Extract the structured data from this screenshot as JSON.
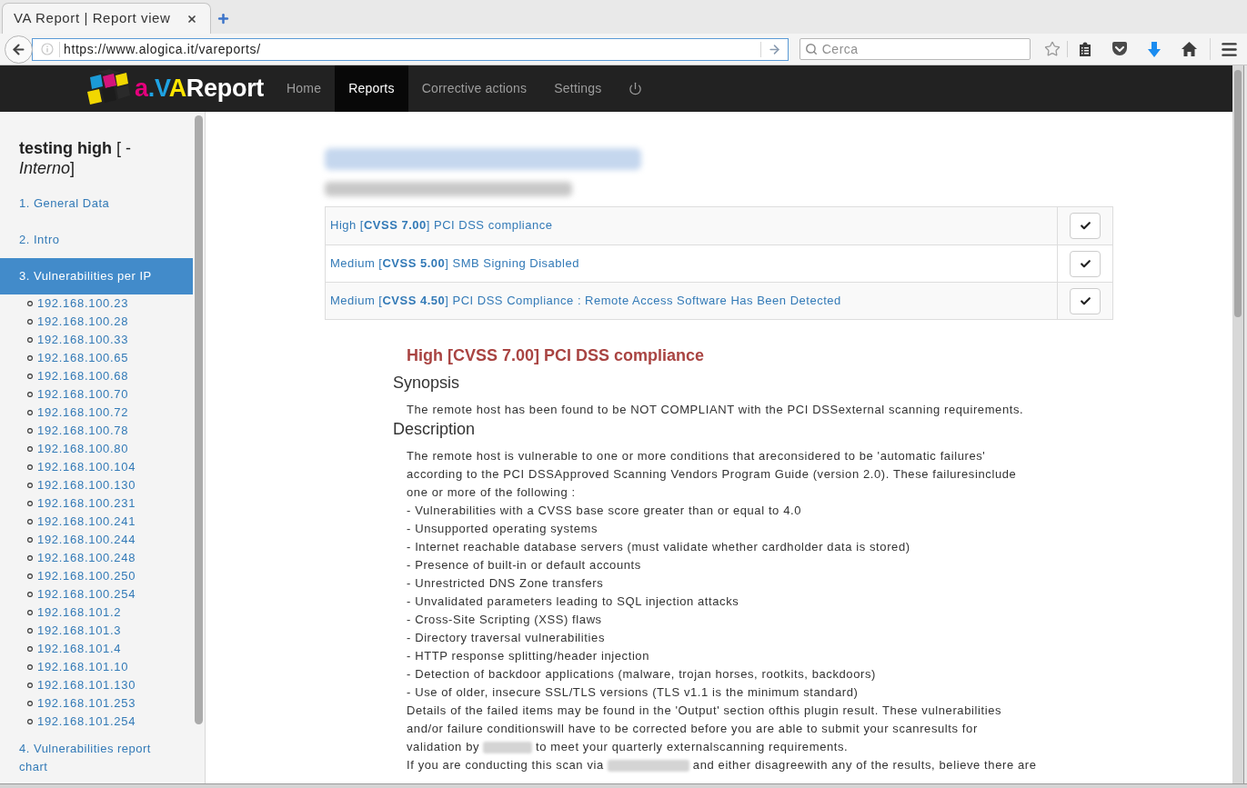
{
  "browser": {
    "tab": {
      "title": "VA Report | Report view"
    },
    "address": {
      "url": "https://www.alogica.it/vareports/"
    },
    "search": {
      "placeholder": "Cerca"
    }
  },
  "navbar": {
    "logo": [
      {
        "text": "a",
        "color": "#e5007d"
      },
      {
        "text": ".V",
        "color": "#1fa3e3"
      },
      {
        "text": "A",
        "color": "#ffe500"
      },
      {
        "text": "Report",
        "color": "#ffffff"
      }
    ],
    "items": [
      {
        "label": "Home",
        "selected": false
      },
      {
        "label": "Reports",
        "selected": true
      },
      {
        "label": "Corrective actions",
        "selected": false
      },
      {
        "label": "Settings",
        "selected": false
      }
    ]
  },
  "sidebar": {
    "title": "**testing high** [ - *Interno*]",
    "items": [
      {
        "label": "1. General Data",
        "selected": false
      },
      {
        "label": "2. Intro",
        "selected": false
      },
      {
        "label": "3. Vulnerabilities per IP",
        "selected": true,
        "children": [
          {
            "label": "192.168.100.23"
          },
          {
            "label": "192.168.100.28"
          },
          {
            "label": "192.168.100.33"
          },
          {
            "label": "192.168.100.65"
          },
          {
            "label": "192.168.100.68"
          },
          {
            "label": "192.168.100.70"
          },
          {
            "label": "192.168.100.72"
          },
          {
            "label": "192.168.100.78"
          },
          {
            "label": "192.168.100.80"
          },
          {
            "label": "192.168.100.104"
          },
          {
            "label": "192.168.100.130"
          },
          {
            "label": "192.168.100.231"
          },
          {
            "label": "192.168.100.241"
          },
          {
            "label": "192.168.100.244"
          },
          {
            "label": "192.168.100.248"
          },
          {
            "label": "192.168.100.250"
          },
          {
            "label": "192.168.100.254"
          },
          {
            "label": "192.168.101.2"
          },
          {
            "label": "192.168.101.3"
          },
          {
            "label": "192.168.101.4"
          },
          {
            "label": "192.168.101.10"
          },
          {
            "label": "192.168.101.130"
          },
          {
            "label": "192.168.101.253"
          },
          {
            "label": "192.168.101.254"
          }
        ]
      },
      {
        "label": "4. Vulnerabilities report chart",
        "selected": false
      }
    ]
  },
  "findings": {
    "rows": [
      {
        "title": "High [**CVSS 7.00**] PCI DSS compliance"
      },
      {
        "title": "Medium [**CVSS 5.00**] SMB Signing Disabled"
      },
      {
        "title": "Medium [**CVSS 4.50**] PCI DSS Compliance : Remote Access Software Has Been Detected"
      }
    ]
  },
  "detail": {
    "title": "High [CVSS 7.00] PCI DSS compliance",
    "sections": [
      {
        "heading": "Synopsis",
        "paragraphs": [
          [
            {
              "kind": "text",
              "text": "The remote host has been found to be NOT COMPLIANT with the PCI DSSexternal scanning requirements."
            }
          ]
        ]
      },
      {
        "heading": "Description",
        "paragraphs": [
          [
            {
              "kind": "text",
              "text": "The remote host is vulnerable to one or more conditions that areconsidered to be 'automatic failures' according to the PCI DSSApproved Scanning Vendors Program Guide (version 2.0). These failuresinclude one or more of the following :"
            }
          ],
          [
            {
              "kind": "text",
              "text": "- Vulnerabilities with a CVSS base score greater than or equal to 4.0"
            }
          ],
          [
            {
              "kind": "text",
              "text": "- Unsupported operating systems"
            }
          ],
          [
            {
              "kind": "text",
              "text": "- Internet reachable database servers (must validate whether cardholder data is stored)"
            }
          ],
          [
            {
              "kind": "text",
              "text": "- Presence of built-in or default accounts"
            }
          ],
          [
            {
              "kind": "text",
              "text": "- Unrestricted DNS Zone transfers"
            }
          ],
          [
            {
              "kind": "text",
              "text": "- Unvalidated parameters leading to SQL injection attacks"
            }
          ],
          [
            {
              "kind": "text",
              "text": "- Cross-Site Scripting (XSS) flaws"
            }
          ],
          [
            {
              "kind": "text",
              "text": "- Directory traversal vulnerabilities"
            }
          ],
          [
            {
              "kind": "text",
              "text": "- HTTP response splitting/header injection"
            }
          ],
          [
            {
              "kind": "text",
              "text": "- Detection of backdoor applications (malware, trojan horses, rootkits, backdoors)"
            }
          ],
          [
            {
              "kind": "text",
              "text": "- Use of older, insecure SSL/TLS versions (TLS v1.1 is the minimum standard)"
            }
          ],
          [
            {
              "kind": "text",
              "text": "Details of the failed items may be found in the 'Output' section ofthis plugin result. These vulnerabilities"
            }
          ],
          [
            {
              "kind": "text",
              "text": "and/or failure conditionswill have to be corrected before you are able to submit your scanresults for"
            }
          ],
          [
            {
              "kind": "text",
              "text": "validation by"
            },
            {
              "kind": "redacted"
            },
            {
              "kind": "text",
              "text": "to meet your quarterly externalscanning requirements."
            }
          ],
          [
            {
              "kind": "text",
              "text": "If you are conducting this scan via"
            },
            {
              "kind": "redacted"
            },
            {
              "kind": "text",
              "text": "and either disagreewith any of the results, believe there are"
            }
          ]
        ]
      }
    ]
  }
}
